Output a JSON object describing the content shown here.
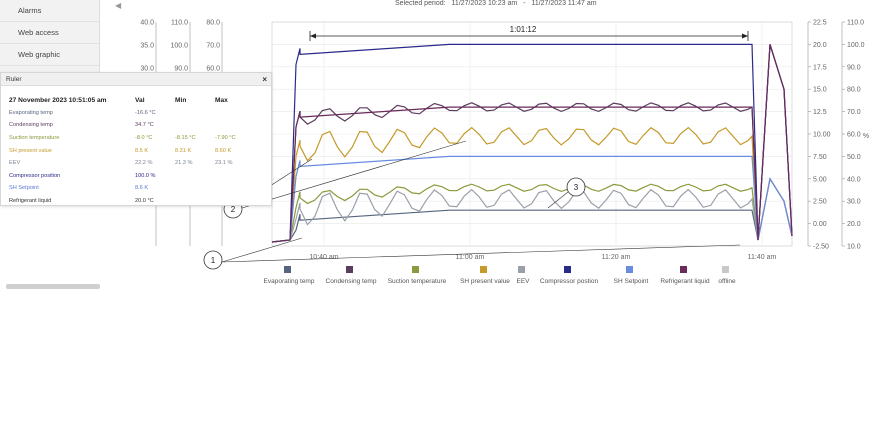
{
  "sidebar": {
    "items": [
      {
        "label": "Alarms"
      },
      {
        "label": "Web access"
      },
      {
        "label": "Web graphic"
      }
    ],
    "collapse_glyph": "◀"
  },
  "header": {
    "period_label": "Selected period:",
    "period_start": "11/27/2023 10:23 am",
    "period_sep": "-",
    "period_end": "11/27/2023 11:47 am"
  },
  "ruler": {
    "title": "Ruler",
    "close_glyph": "×",
    "timestamp": "27 November 2023 10:51:05 am",
    "col_val": "Val",
    "col_min": "Min",
    "col_max": "Max",
    "rows": [
      {
        "name": "Evaporating temp",
        "val": "-16.6 °C",
        "min": "",
        "max": "",
        "color": "#56657e"
      },
      {
        "name": "Condensing temp",
        "val": "34.7 °C",
        "min": "",
        "max": "",
        "color": "#5a3c5e"
      },
      {
        "name": "Suction temperature",
        "val": "-8.0 °C",
        "min": "-8.15 °C",
        "max": "-7.90 °C",
        "color": "#8a9a3c"
      },
      {
        "name": "SH present value",
        "val": "8.5 K",
        "min": "8.31 K",
        "max": "8.60 K",
        "color": "#c59a2a"
      },
      {
        "name": "EEV",
        "val": "22.2 %",
        "min": "21.3 %",
        "max": "23.1 %",
        "color": "#7a8494"
      },
      {
        "name": "Compressor position",
        "val": "100.0 %",
        "min": "",
        "max": "",
        "color": "#2a2a8a"
      },
      {
        "name": "SH Setpoint",
        "val": "8.6 K",
        "min": "",
        "max": "",
        "color": "#5a78d4"
      },
      {
        "name": "Refrigerant liquid",
        "val": "20.0 °C",
        "min": "",
        "max": "",
        "color": "#333333"
      }
    ]
  },
  "annotations": {
    "duration": "1:01:12",
    "callouts": [
      "1",
      "2",
      "3"
    ]
  },
  "legend": [
    {
      "name": "Evaporating temp",
      "color": "#56657e"
    },
    {
      "name": "Condensing temp",
      "color": "#5a3c5e"
    },
    {
      "name": "Suction temperature",
      "color": "#8a9a3c"
    },
    {
      "name": "SH present value",
      "color": "#c59a2a"
    },
    {
      "name": "EEV",
      "color": "#9aa0aa"
    },
    {
      "name": "Compressor postion",
      "color": "#2a2a8a"
    },
    {
      "name": "SH Setpoint",
      "color": "#6a8ce0"
    },
    {
      "name": "Refrigerant liquid",
      "color": "#6a2a5a"
    },
    {
      "name": "offline",
      "color": "#c8c8c8"
    }
  ],
  "chart_data": {
    "type": "line",
    "x_ticks": [
      "10:40 am",
      "11:00 am",
      "11:20 am",
      "11:40 am"
    ],
    "left_axes": [
      {
        "ticks": [
          "40.0",
          "35.0",
          "30.0"
        ],
        "tick_values": [
          40,
          35,
          30
        ]
      },
      {
        "ticks": [
          "110.0",
          "100.0",
          "90.0"
        ],
        "tick_values": [
          110,
          100,
          90
        ]
      },
      {
        "ticks": [
          "80.0",
          "70.0",
          "60.0"
        ],
        "tick_values": [
          80,
          70,
          60
        ]
      }
    ],
    "right_axes": [
      {
        "ticks": [
          "22.5",
          "20.0",
          "17.5",
          "15.0",
          "12.5",
          "10.00",
          "7.50",
          "5.00",
          "2.50",
          "0.00",
          "-2.50"
        ],
        "tick_values": [
          22.5,
          20,
          17.5,
          15,
          12.5,
          10,
          7.5,
          5,
          2.5,
          0,
          -2.5
        ]
      },
      {
        "ticks": [
          "110.0",
          "100.0",
          "90.0",
          "80.0",
          "70.0",
          "60.0",
          "50.0",
          "40.0",
          "30.0",
          "20.0",
          "10.0"
        ],
        "tick_values": [
          110,
          100,
          90,
          80,
          70,
          60,
          50,
          40,
          30,
          20,
          10
        ]
      }
    ],
    "right_axis_unit": "%",
    "series": [
      {
        "name": "Evaporating temp",
        "color": "#56657e",
        "center": 26,
        "amp": 0
      },
      {
        "name": "Condensing temp",
        "color": "#5a3c5e",
        "center": 72,
        "amp": 1.2
      },
      {
        "name": "Suction temperature",
        "color": "#8a9a3c",
        "center": 36,
        "amp": 1.0
      },
      {
        "name": "SH present value",
        "color": "#c59a2a",
        "center": 59,
        "amp": 2.4
      },
      {
        "name": "EEV",
        "color": "#9aa0aa",
        "center": 31,
        "amp": 2.6
      },
      {
        "name": "Compressor postion",
        "color": "#2a2a8a",
        "center": 100,
        "amp": 0
      },
      {
        "name": "SH Setpoint",
        "color": "#6a8ce0",
        "center": 50,
        "amp": 0
      },
      {
        "name": "Refrigerant liquid",
        "color": "#6a2a5a",
        "center": 72,
        "amp": 0
      }
    ]
  }
}
